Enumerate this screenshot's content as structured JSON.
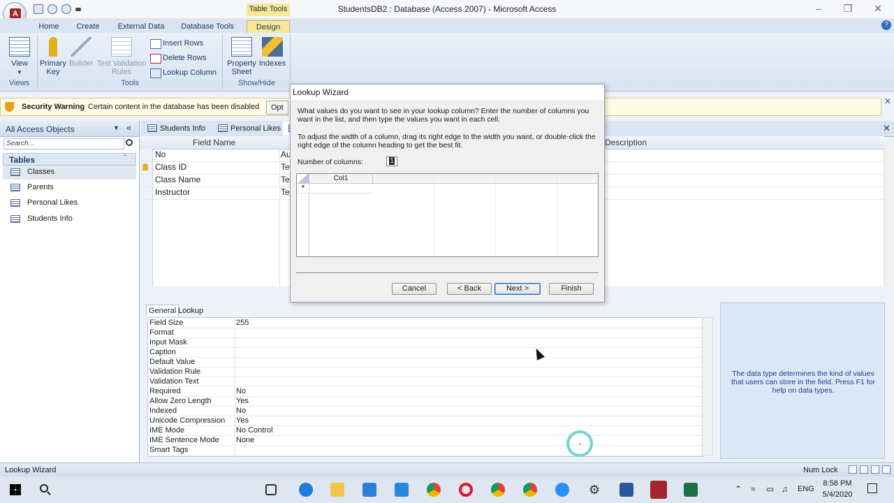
{
  "window": {
    "title": "StudentsDB2 : Database (Access 2007) - Microsoft Access",
    "context_tab": "Table Tools"
  },
  "ribbon": {
    "tabs": [
      "Home",
      "Create",
      "External Data",
      "Database Tools",
      "Design"
    ],
    "active_tab": "Design",
    "groups": {
      "views": "Views",
      "tools": "Tools",
      "show_hide": "Show/Hide"
    },
    "view_label": "View",
    "primary_key_label": "Primary Key",
    "builder_label": "Builder",
    "test_validation_label": "Test Validation Rules",
    "insert_rows": "Insert Rows",
    "delete_rows": "Delete Rows",
    "lookup_column": "Lookup Column",
    "property_sheet": "Property Sheet",
    "indexes": "Indexes"
  },
  "security_bar": {
    "title": "Security Warning",
    "message": "Certain content in the database has been disabled",
    "options_button": "Opt"
  },
  "nav": {
    "title": "All Access Objects",
    "search_placeholder": "Search...",
    "group": "Tables",
    "items": [
      "Classes",
      "Parents",
      "Personal Likes",
      "Students Info"
    ],
    "selected": "Classes"
  },
  "doc_tabs": [
    "Students Info",
    "Personal Likes",
    "Cl"
  ],
  "design_grid": {
    "headers": {
      "field_name": "Field Name",
      "data_type": "Data Type",
      "description": "Description"
    },
    "rows": [
      {
        "field": "No",
        "type": "Au",
        "primary_key": false
      },
      {
        "field": "Class ID",
        "type": "Te",
        "primary_key": true
      },
      {
        "field": "Class Name",
        "type": "Te",
        "primary_key": false
      },
      {
        "field": "Instructor",
        "type": "Te",
        "primary_key": false
      }
    ]
  },
  "field_properties": {
    "tabs": [
      "General",
      "Lookup"
    ],
    "rows": [
      {
        "label": "Field Size",
        "value": "255"
      },
      {
        "label": "Format",
        "value": ""
      },
      {
        "label": "Input Mask",
        "value": ""
      },
      {
        "label": "Caption",
        "value": ""
      },
      {
        "label": "Default Value",
        "value": ""
      },
      {
        "label": "Validation Rule",
        "value": ""
      },
      {
        "label": "Validation Text",
        "value": ""
      },
      {
        "label": "Required",
        "value": "No"
      },
      {
        "label": "Allow Zero Length",
        "value": "Yes"
      },
      {
        "label": "Indexed",
        "value": "No"
      },
      {
        "label": "Unicode Compression",
        "value": "Yes"
      },
      {
        "label": "IME Mode",
        "value": "No Control"
      },
      {
        "label": "IME Sentence Mode",
        "value": "None"
      },
      {
        "label": "Smart Tags",
        "value": ""
      }
    ],
    "help": "The data type determines the kind of values that users can store in the field.  Press F1 for help on data types."
  },
  "dialog": {
    "title": "Lookup Wizard",
    "paragraph1": "What values do you want to see in your lookup column? Enter the number of columns you want in the list, and then type the values you want in each cell.",
    "paragraph2": "To adjust the width of a column, drag its right edge to the width you want, or double-click the right edge of the column heading to get the best fit.",
    "num_columns_label": "Number of columns:",
    "num_columns_value": "1",
    "col_header": "Col1",
    "new_row_marker": "*",
    "buttons": {
      "cancel": "Cancel",
      "back": "< Back",
      "next": "Next >",
      "finish": "Finish"
    }
  },
  "status_bar": {
    "text": "Lookup Wizard",
    "num_lock": "Num Lock"
  },
  "taskbar": {
    "language": "ENG",
    "time": "8:58 PM",
    "date": "5/4/2020"
  },
  "colors": {
    "context_tab": "#f6e79a",
    "help_text": "#1e3c8c",
    "accent": "#2b6fc0"
  }
}
